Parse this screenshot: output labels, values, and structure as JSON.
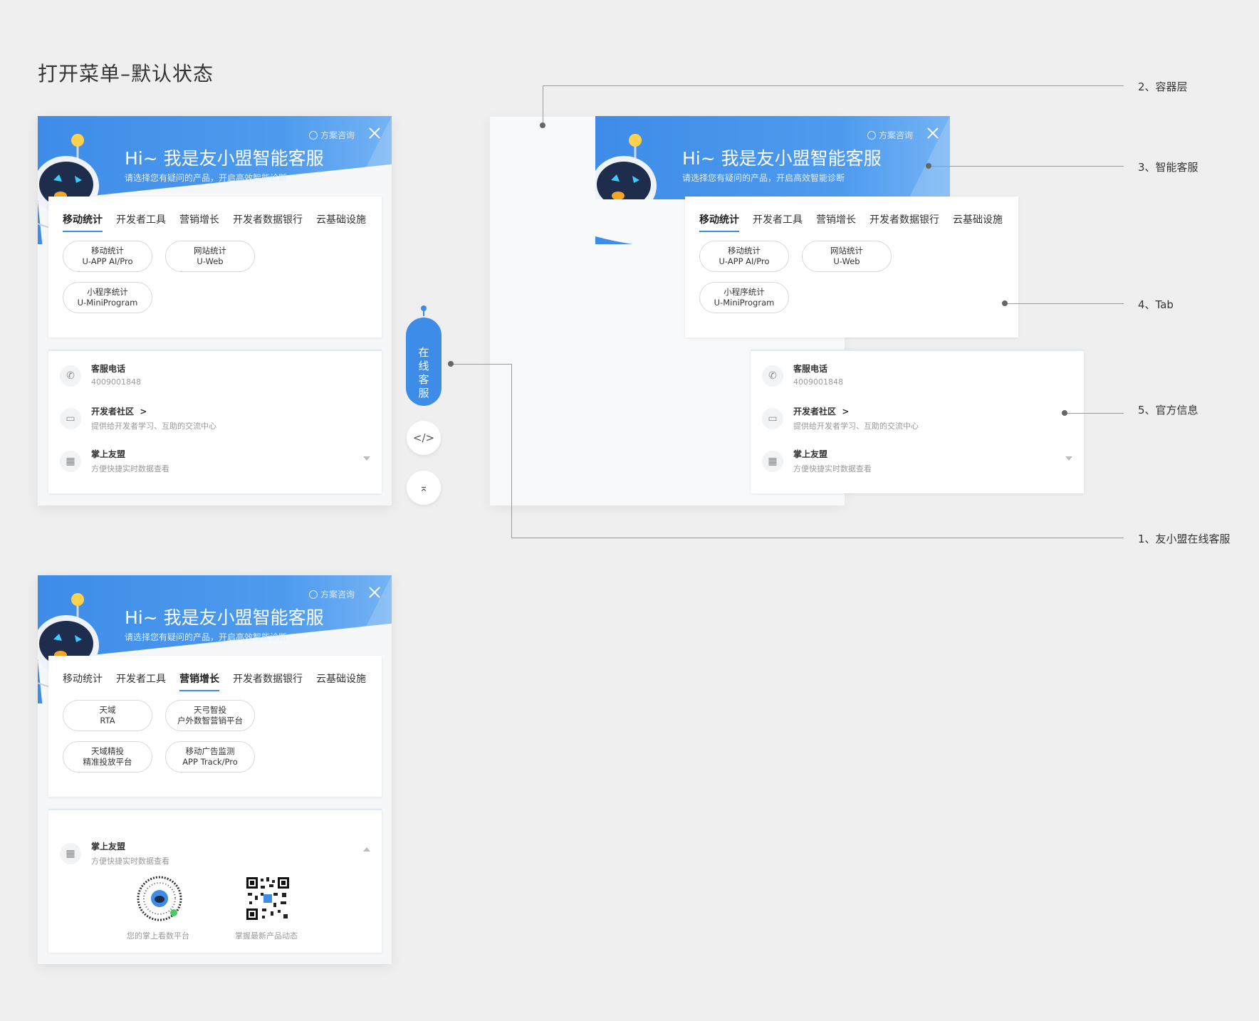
{
  "page_title": "打开菜单–默认状态",
  "header": {
    "hi": "Hi~ 我是友小盟智能客服",
    "subtitle": "请选择您有疑问的产品，开启高效智能诊断",
    "consult": "方案咨询"
  },
  "tabs": [
    "移动统计",
    "开发者工具",
    "营销增长",
    "开发者数据银行",
    "云基础设施"
  ],
  "panel1": {
    "active_tab": "移动统计",
    "pills": [
      {
        "line1": "移动统计",
        "line2": "U-APP AI/Pro"
      },
      {
        "line1": "网站统计",
        "line2": "U-Web"
      },
      {
        "line1": "小程序统计",
        "line2": "U-MiniProgram"
      }
    ]
  },
  "panel3": {
    "active_tab": "营销增长",
    "pills": [
      {
        "line1": "天域",
        "line2": "RTA"
      },
      {
        "line1": "天弓智投",
        "line2": "户外数智营销平台"
      },
      {
        "line1": "天域精投",
        "line2": "精准投放平台"
      },
      {
        "line1": "移动广告监测",
        "line2": "APP Track/Pro"
      }
    ]
  },
  "info": {
    "phone_title": "客服电话",
    "phone_value": "4009001848",
    "community_title": "开发者社区",
    "community_arrow": ">",
    "community_sub": "提供给开发者学习、互助的交流中心",
    "app_title": "掌上友盟",
    "app_sub": "方便快捷实时数据查看"
  },
  "qr": {
    "left_label": "您的掌上看数平台",
    "right_label": "掌握最新产品动态"
  },
  "float": {
    "label": "在线客服"
  },
  "annotations": {
    "a1": "1、友小盟在线客服",
    "a2": "2、容器层",
    "a3": "3、智能客服",
    "a4": "4、Tab",
    "a5": "5、官方信息"
  },
  "colors": {
    "brand": "#3d8ce8",
    "background": "#efefef"
  }
}
